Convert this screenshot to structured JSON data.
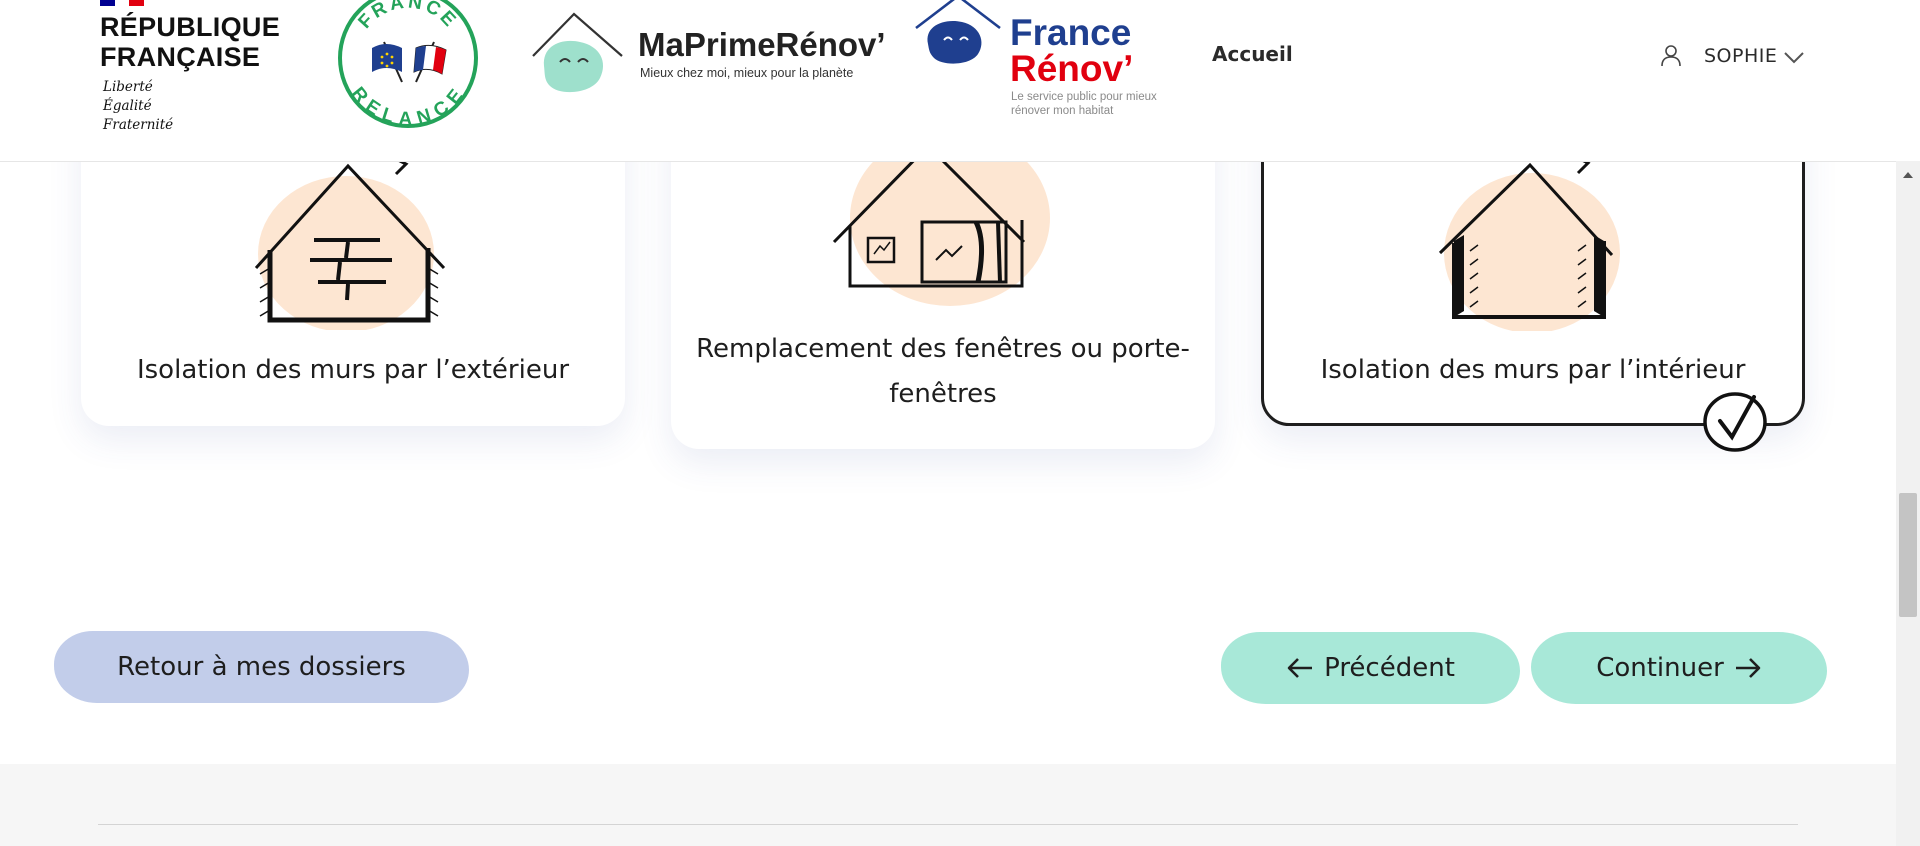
{
  "header": {
    "republique": {
      "name": "RÉPUBLIQUE\nFRANÇAISE",
      "motto": "Liberté\nÉgalité\nFraternité",
      "flag_colors": [
        "#000091",
        "#ffffff",
        "#e1000f"
      ]
    },
    "france_relance": {
      "top_text": "FRANCE",
      "bottom_text": "RELANCE",
      "color": "#24a35a"
    },
    "maprimerenov": {
      "title": "MaPrimeRénov’",
      "tagline": "Mieux chez moi, mieux pour la planète",
      "blob_color": "#9ee0cc"
    },
    "france_renov": {
      "line1": "France",
      "line2": "Rénov’",
      "subtitle": "Le service public pour mieux rénover mon habitat",
      "blue": "#1f3f8f",
      "red": "#e1000f"
    },
    "nav": {
      "accueil": "Accueil"
    },
    "user": {
      "name": "SOPHIE",
      "icon": "user-icon",
      "dropdown_icon": "chevron-down-icon"
    }
  },
  "works": {
    "cards": [
      {
        "label": "Isolation des murs par l’extérieur",
        "illustration": "house-exterior-insulation",
        "selected": false
      },
      {
        "label": "Remplacement des fenêtres ou porte-fenêtres",
        "illustration": "house-windows",
        "selected": false
      },
      {
        "label": "Isolation des murs par l’intérieur",
        "illustration": "house-interior-insulation",
        "selected": true
      }
    ]
  },
  "actions": {
    "back": "Retour à mes dossiers",
    "previous": "Précédent",
    "continue": "Continuer"
  },
  "colors": {
    "accent_mint": "#a8e8d8",
    "accent_blue": "#c2cdea",
    "blob_peach": "#fde6d2"
  }
}
